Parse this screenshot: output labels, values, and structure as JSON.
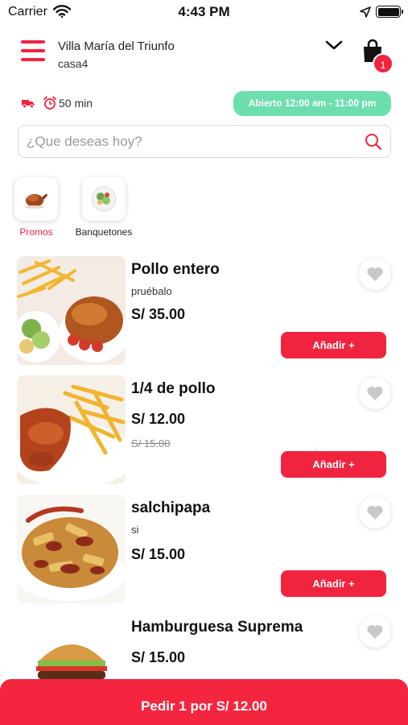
{
  "status_bar": {
    "carrier": "Carrier",
    "time": "4:43 PM"
  },
  "header": {
    "address_title": "Villa María del Triunfo",
    "address_subtitle": "casa4",
    "cart_count": "1"
  },
  "delivery": {
    "time": "50 min",
    "open_hours": "Abierto 12:00 am - 11:00 pm"
  },
  "search": {
    "placeholder": "¿Que deseas hoy?"
  },
  "categories": [
    {
      "label": "Promos",
      "active": true
    },
    {
      "label": "Banquetones",
      "active": false
    }
  ],
  "products": [
    {
      "name": "Pollo entero",
      "description": "pruébalo",
      "price": "S/ 35.00",
      "old_price": "",
      "add_label": "Añadir +"
    },
    {
      "name": "1/4 de pollo",
      "description": "",
      "price": "S/ 12.00",
      "old_price": "S/ 15.00",
      "add_label": "Añadir +"
    },
    {
      "name": "salchipapa",
      "description": "si",
      "price": "S/ 15.00",
      "old_price": "",
      "add_label": "Añadir +"
    },
    {
      "name": "Hamburguesa Suprema",
      "description": "",
      "price": "S/ 15.00",
      "old_price": "",
      "add_label": ""
    }
  ],
  "order_bar": {
    "label": "Pedir 1 por S/ 12.00"
  },
  "colors": {
    "accent": "#f0243e",
    "open_badge": "#6ddfae"
  },
  "icons": [
    "wifi-icon",
    "location-icon",
    "battery-icon",
    "menu-icon",
    "chevron-down-icon",
    "shopping-bag-icon",
    "delivery-truck-icon",
    "alarm-clock-icon",
    "search-icon",
    "heart-icon"
  ]
}
